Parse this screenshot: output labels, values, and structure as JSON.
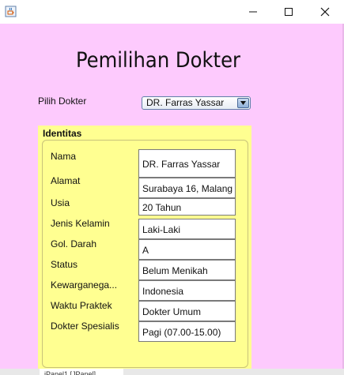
{
  "window": {
    "minimize_icon": "minimize-icon",
    "maximize_icon": "maximize-icon",
    "close_icon": "close-icon",
    "app_icon": "java-cup-icon"
  },
  "header": {
    "title": "Pemilihan Dokter"
  },
  "selector": {
    "label": "Pilih Dokter",
    "selected": "DR. Farras Yassar"
  },
  "identitas": {
    "title": "Identitas",
    "labels": [
      "Nama",
      "Alamat",
      "Usia",
      "Jenis Kelamin",
      "Gol. Darah",
      "Status",
      "Kewarganega...",
      "Waktu Praktek",
      "Dokter Spesialis"
    ],
    "values": [
      "DR. Farras Yassar",
      "Surabaya 16, Malang",
      "20 Tahun",
      "Laki-Laki",
      "A",
      "Belum Menikah",
      "Indonesia",
      "Dokter Umum",
      "Pagi (07.00-15.00)"
    ]
  },
  "bottom": {
    "tab_label": "jPanel1 [JPanel]"
  },
  "colors": {
    "background": "#fdcafd",
    "panel": "#ffff91",
    "accent": "#5f7fa8"
  }
}
